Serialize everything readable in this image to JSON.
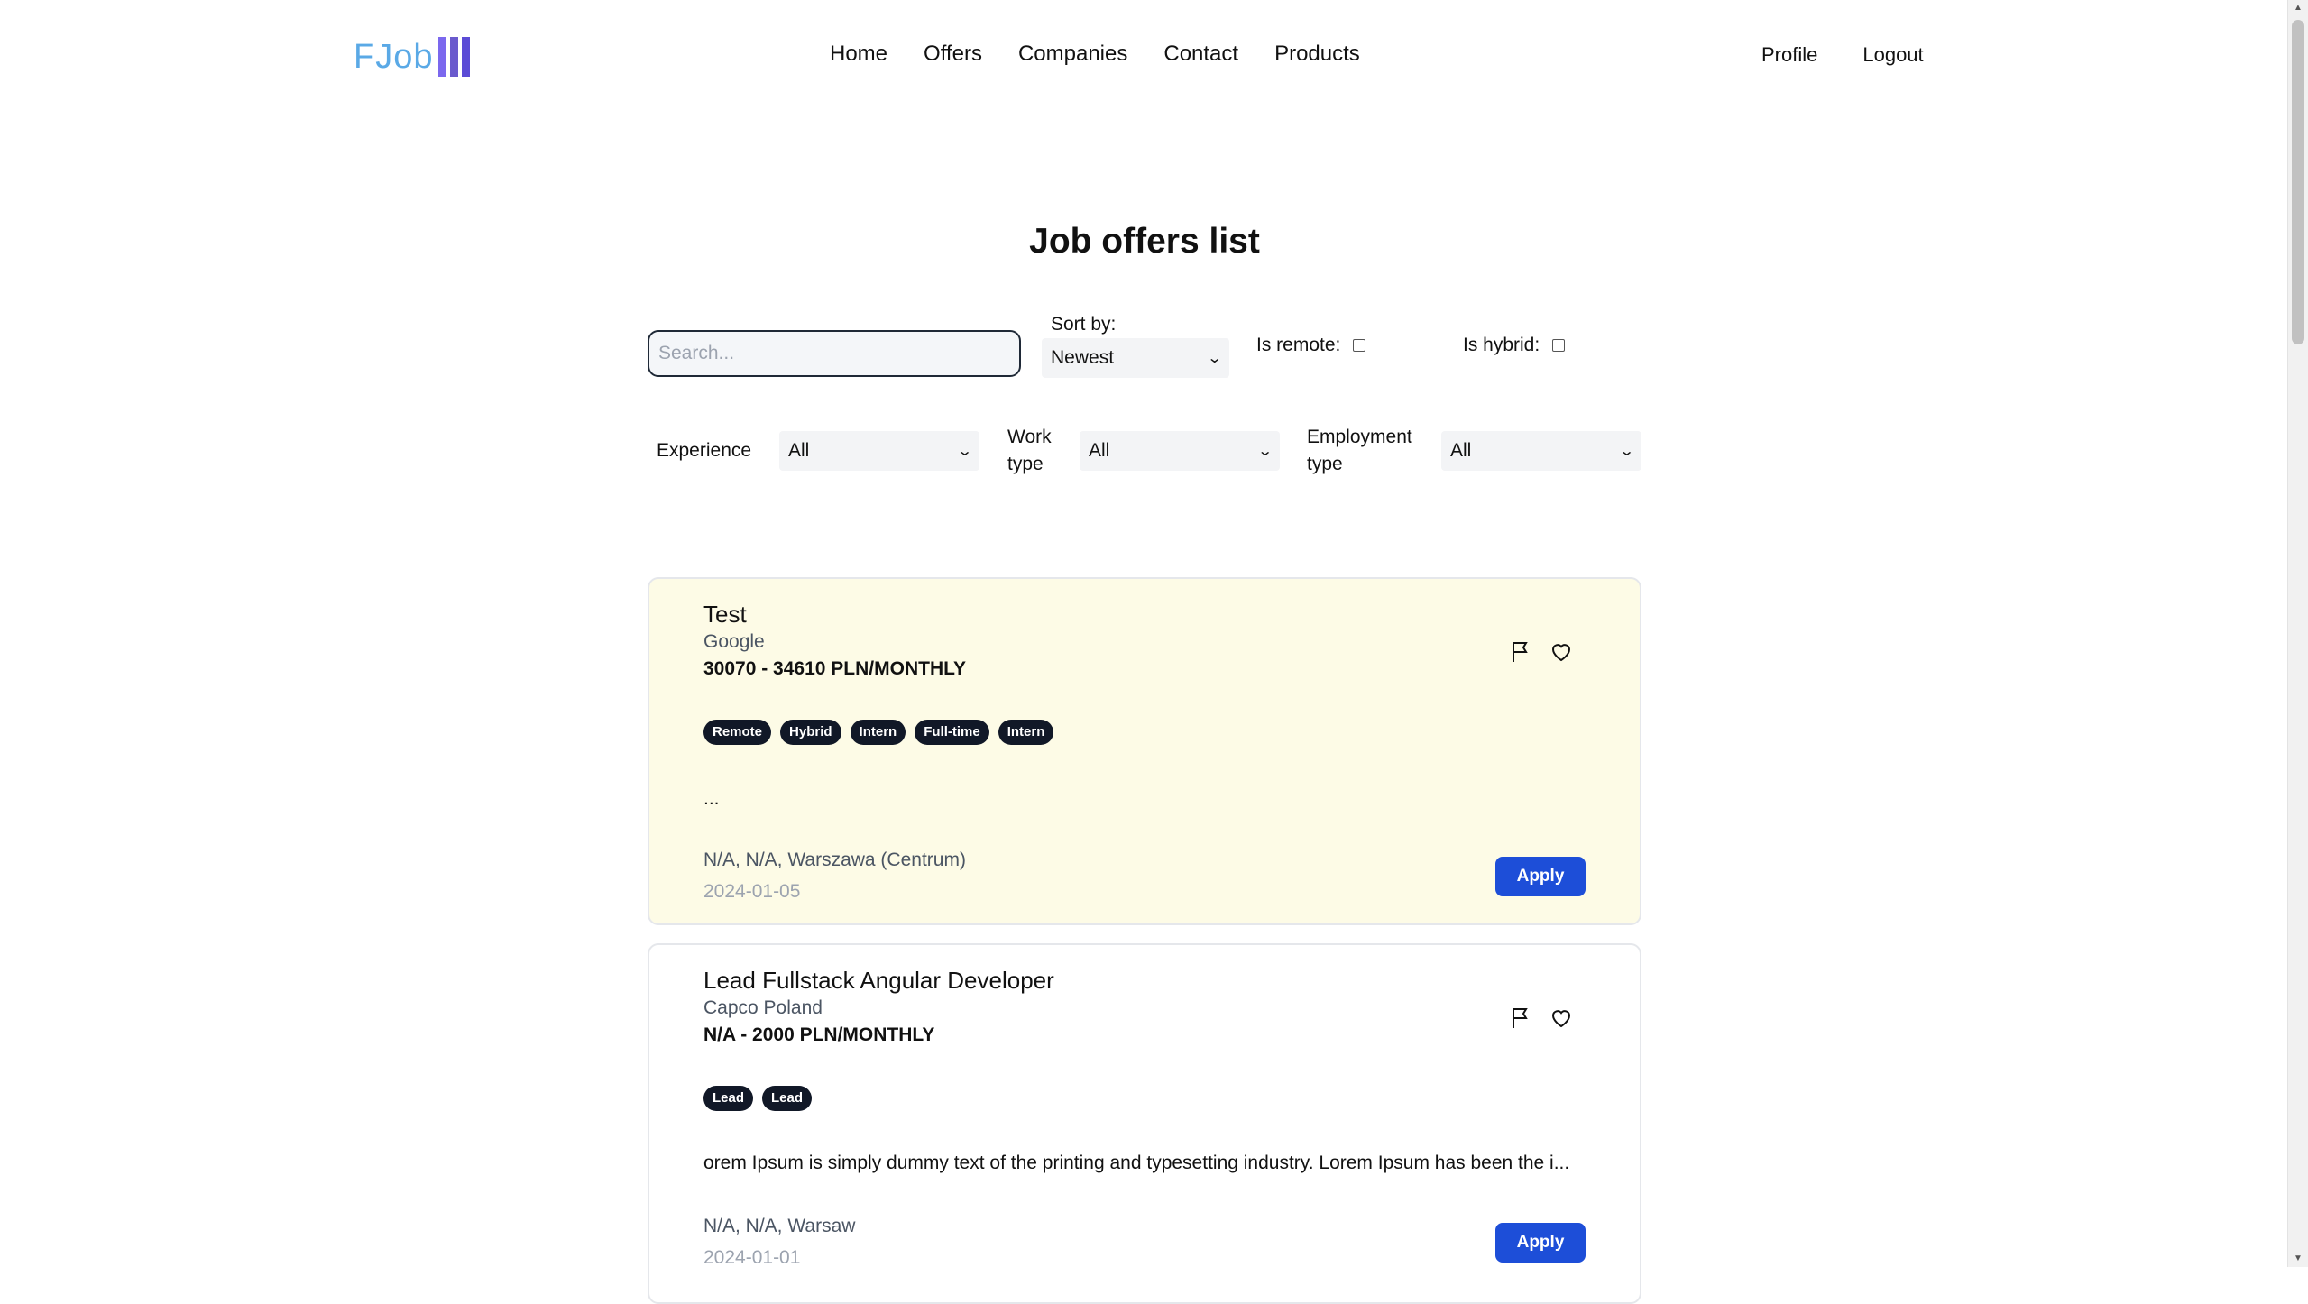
{
  "header": {
    "logo_text": "FJob",
    "nav": [
      "Home",
      "Offers",
      "Companies",
      "Contact",
      "Products"
    ],
    "account": [
      "Profile",
      "Logout"
    ]
  },
  "page": {
    "title": "Job offers list"
  },
  "filters": {
    "search_placeholder": "Search...",
    "sort_label": "Sort by:",
    "sort_value": "Newest",
    "remote_label": "Is remote:",
    "remote_checked": false,
    "hybrid_label": "Is hybrid:",
    "hybrid_checked": false,
    "experience_label": "Experience",
    "experience_value": "All",
    "work_type_label_1": "Work",
    "work_type_label_2": "type",
    "work_type_value": "All",
    "employment_label_1": "Employment",
    "employment_label_2": "type",
    "employment_value": "All"
  },
  "offers": [
    {
      "title": "Test",
      "company": "Google",
      "salary": "30070 - 34610 PLN/MONTHLY",
      "tags": [
        "Remote",
        "Hybrid",
        "Intern",
        "Full-time",
        "Intern"
      ],
      "description": "...",
      "location": "N/A, N/A, Warszawa (Centrum)",
      "date": "2024-01-05",
      "apply_label": "Apply"
    },
    {
      "title": "Lead Fullstack Angular Developer",
      "company": "Capco Poland",
      "salary": "N/A - 2000 PLN/MONTHLY",
      "tags": [
        "Lead",
        "Lead"
      ],
      "description": "orem Ipsum is simply dummy text of the printing and typesetting industry. Lorem Ipsum has been the i...",
      "location": "N/A, N/A, Warsaw",
      "date": "2024-01-01",
      "apply_label": "Apply"
    }
  ],
  "icons": {
    "flag": "flag-icon",
    "heart": "heart-icon"
  },
  "colors": {
    "accent": "#1d4ed8",
    "highlight_card": "#fdfbe6",
    "tag_bg": "#111827",
    "logo_text": "#5aa9e6",
    "logo_bars": "#7b68ee"
  }
}
